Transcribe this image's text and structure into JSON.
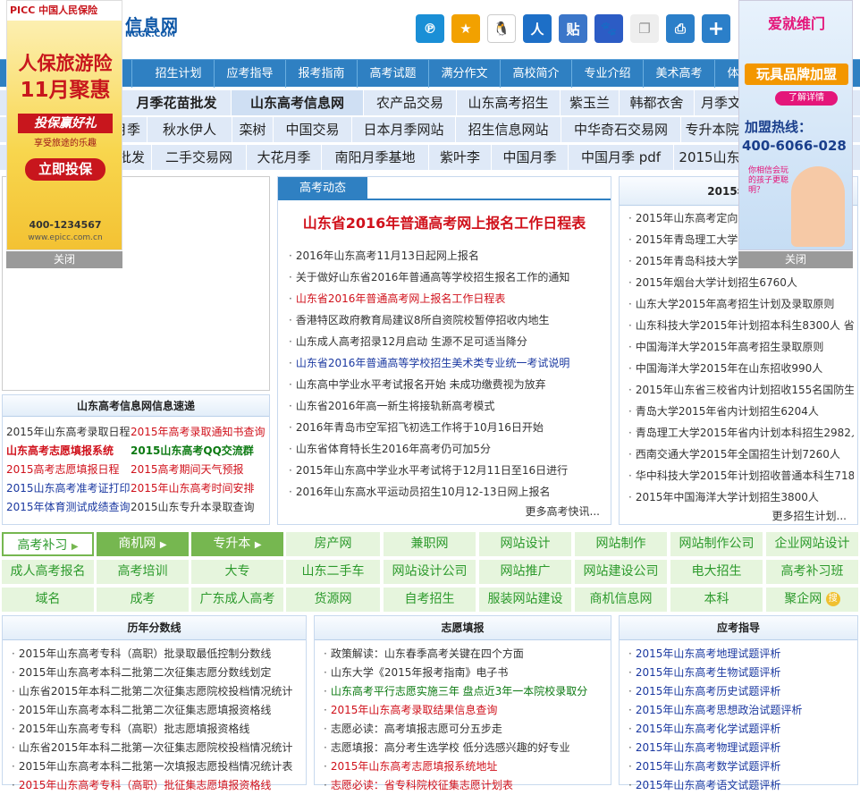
{
  "header": {
    "site_name": "信息网",
    "site_url": "NGGK.COM",
    "share_icons": [
      "qzone-icon",
      "favorite-icon",
      "qq-icon",
      "renren-icon",
      "tieba-icon",
      "baidu-icon",
      "copy-icon",
      "print-icon",
      "plus-icon"
    ]
  },
  "nav": {
    "items": [
      "态",
      "招生计划",
      "应考指导",
      "报考指南",
      "高考试题",
      "满分作文",
      "高校简介",
      "专业介绍",
      "美术高考",
      "体"
    ]
  },
  "keywords": {
    "row1": [
      "月季花苗批发",
      "山东高考信息网",
      "农产品交易",
      "山东高考招生",
      "紫玉兰",
      "韩都衣舍",
      "月季文"
    ],
    "row2": [
      "月季",
      "秋水伊人",
      "栾树",
      "中国交易",
      "日本月季网站",
      "招生信息网站",
      "中华奇石交易网",
      "专升本院"
    ],
    "row3": [
      "批发",
      "二手交易网",
      "大花月季",
      "南阳月季基地",
      "紫叶李",
      "中国月季",
      "中国月季 pdf",
      "2015山东"
    ]
  },
  "news": {
    "tab": "高考动态",
    "headline": "山东省2016年普通高考网上报名工作日程表",
    "items": [
      {
        "text": "2016年山东高考11月13日起网上报名",
        "color": "normal"
      },
      {
        "text": "关于做好山东省2016年普通高等学校招生报名工作的通知",
        "color": "normal"
      },
      {
        "text": "山东省2016年普通高考网上报名工作日程表",
        "color": "red"
      },
      {
        "text": "香港特区政府教育局建议8所自资院校暂停招收内地生",
        "color": "normal"
      },
      {
        "text": "山东成人高考招录12月启动 生源不足可适当降分",
        "color": "normal"
      },
      {
        "text": "山东省2016年普通高等学校招生美术类专业统一考试说明",
        "color": "blue"
      },
      {
        "text": "山东高中学业水平考试报名开始 未成功缴费视为放弃",
        "color": "normal"
      },
      {
        "text": "山东省2016年高一新生将接轨新高考模式",
        "color": "normal"
      },
      {
        "text": "2016年青岛市空军招飞初选工作将于10月16日开始",
        "color": "normal"
      },
      {
        "text": "山东省体育特长生2016年高考仍可加5分",
        "color": "normal"
      },
      {
        "text": "2015年山东高中学业水平考试将于12月11日至16日进行",
        "color": "normal"
      },
      {
        "text": "2016年山东高水平运动员招生10月12-13日网上报名",
        "color": "normal"
      }
    ],
    "more": "更多高考快讯..."
  },
  "recruit": {
    "title": "2015年高校",
    "items": [
      "2015年山东高考定向培",
      "2015年青岛理工大学在",
      "2015年青岛科技大学在",
      "2015年烟台大学计划招生6760人",
      "山东大学2015年高考招生计划及录取原则",
      "山东科技大学2015年计划招本科生8300人 省",
      "中国海洋大学2015年高考招生录取原则",
      "中国海洋大学2015年在山东招收990人",
      "2015年山东省三校省内计划招收155名国防生",
      "青岛大学2015年省内计划招生6204人",
      "青岛理工大学2015年省内计划本科招生2982人",
      "西南交通大学2015年全国招生计划7260人",
      "华中科技大学2015年计划招收普通本科生718",
      "2015年中国海洋大学计划招生3800人"
    ],
    "more": "更多招生计划..."
  },
  "express": {
    "title": "山东高考信息网信息速递",
    "rows": [
      [
        {
          "text": "2015年山东高考录取日程",
          "color": "normal"
        },
        {
          "text": "2015年高考录取通知书查询",
          "color": "red"
        }
      ],
      [
        {
          "text": "山东高考志愿填报系统",
          "color": "red_bold"
        },
        {
          "text": "2015山东高考QQ交流群",
          "color": "green_bold"
        }
      ],
      [
        {
          "text": "2015高考志愿填报日程",
          "color": "red"
        },
        {
          "text": "2015高考期间天气预报",
          "color": "red"
        }
      ],
      [
        {
          "text": "2015山东高考准考证打印",
          "color": "blue"
        },
        {
          "text": "2015年山东高考时间安排",
          "color": "red"
        }
      ],
      [
        {
          "text": "2015年体育测试成绩查询",
          "color": "blue"
        },
        {
          "text": "2015山东专升本录取查询",
          "color": "normal"
        }
      ]
    ]
  },
  "links": {
    "row1": [
      "高考补习",
      "商机网",
      "专升本",
      "房产网",
      "兼职网",
      "网站设计",
      "网站制作",
      "网站制作公司",
      "企业网站设计"
    ],
    "row2": [
      "成人高考报名",
      "高考培训",
      "大专",
      "山东二手车",
      "网站设计公司",
      "网站推广",
      "网站建设公司",
      "电大招生",
      "高考补习班"
    ],
    "row3": [
      "域名",
      "成考",
      "广东成人高考",
      "货源网",
      "自考招生",
      "服装网站建设",
      "商机信息网",
      "本科",
      "聚企网"
    ]
  },
  "scores": {
    "title": "历年分数线",
    "items": [
      "2015年山东高考专科（高职）批录取最低控制分数线",
      "2015年山东高考本科二批第二次征集志愿分数线划定",
      "山东省2015年本科二批第二次征集志愿院校投档情况统计",
      "2015年山东高考本科二批第二次征集志愿填报资格线",
      "2015年山东高考专科（高职）批志愿填报资格线",
      "山东省2015年本科二批第一次征集志愿院校投档情况统计",
      "2015年山东高考本科二批第一次填报志愿投档情况统计表",
      "2015年山东高考专科（高职）批征集志愿填报资格线"
    ]
  },
  "volunteer": {
    "title": "志愿填报",
    "items": [
      {
        "text": "政策解读：山东春季高考关键在四个方面",
        "color": "normal"
      },
      {
        "text": "山东大学《2015年报考指南》电子书",
        "color": "normal"
      },
      {
        "text": "山东高考平行志愿实施三年 盘点近3年一本院校录取分",
        "color": "green"
      },
      {
        "text": "2015年山东高考录取结果信息查询",
        "color": "red"
      },
      {
        "text": "志愿必读：高考填报志愿可分五步走",
        "color": "normal"
      },
      {
        "text": "志愿填报：高分考生选学校 低分选感兴趣的好专业",
        "color": "normal"
      },
      {
        "text": "2015年山东高考志愿填报系统地址",
        "color": "red"
      },
      {
        "text": "志愿必读：省专科院校征集志愿计划表",
        "color": "red"
      }
    ]
  },
  "guide": {
    "title": "应考指导",
    "items": [
      "2015年山东高考地理试题评析",
      "2015年山东高考生物试题评析",
      "2015年山东高考历史试题评析",
      "2015年山东高考思想政治试题评析",
      "2015年山东高考化学试题评析",
      "2015年山东高考物理试题评析",
      "2015年山东高考数学试题评析",
      "2015年山东高考语文试题评析"
    ]
  },
  "ads": {
    "left": {
      "brand": "PICC 中国人民保险",
      "headline1": "人保旅游险",
      "headline2": "11月聚惠",
      "slogan": "投保赢好礼",
      "sub": "享受旅途的乐趣",
      "cta": "立即投保",
      "phone": "400-1234567",
      "url": "www.epicc.com.cn",
      "close": "关闭"
    },
    "right": {
      "brand": "爱就维门",
      "headline": "玩具品牌加盟",
      "cta": "了解详情",
      "hotline_label": "加盟热线：",
      "hotline": "400-6066-028",
      "bubble": "你相信会玩的孩子更聪明？",
      "close": "关闭"
    }
  },
  "colors": {
    "nav_blue": "#2f80c2",
    "keyword_bg": "#dfe9f7",
    "link_green": "#2c9a2c",
    "red": "#d0111b"
  }
}
